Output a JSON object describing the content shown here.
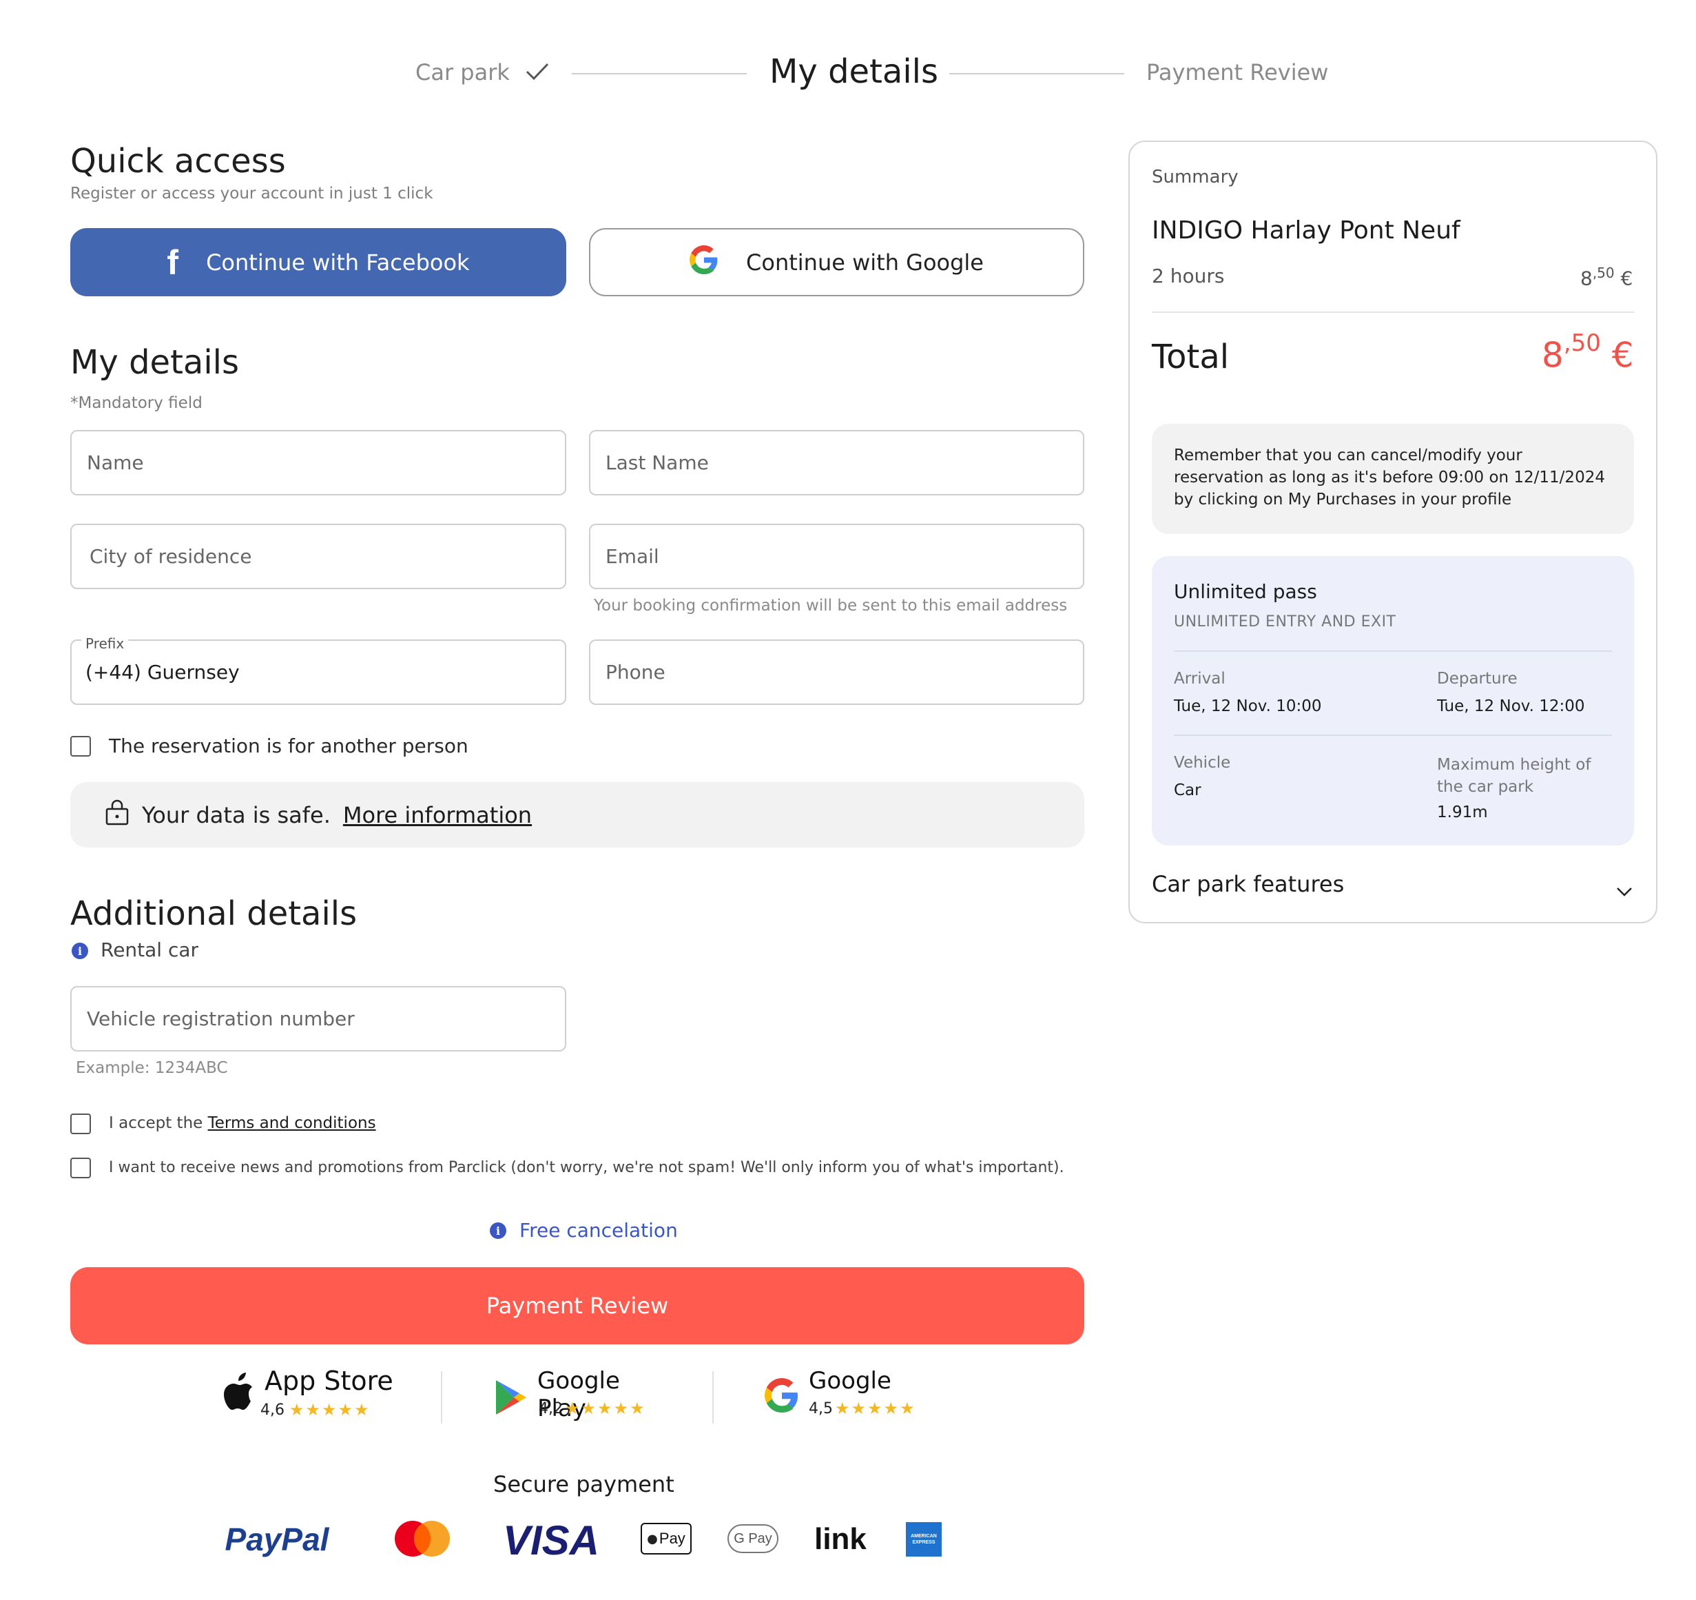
{
  "stepper": {
    "step1": "Car park",
    "step2": "My details",
    "step3": "Payment Review"
  },
  "quick_access": {
    "title": "Quick access",
    "subtitle": "Register or access your account in just 1 click",
    "facebook_label": "Continue with Facebook",
    "google_label": "Continue with Google"
  },
  "my_details": {
    "title": "My details",
    "mandatory": "*Mandatory field",
    "name_placeholder": "Name",
    "last_name_placeholder": "Last Name",
    "city_placeholder": "City of residence",
    "email_placeholder": "Email",
    "email_hint": "Your booking confirmation will be sent to this email address",
    "prefix_label": "Prefix",
    "prefix_value": "(+44) Guernsey",
    "phone_placeholder": "Phone",
    "another_person": "The reservation is for another person",
    "safe_text": "Your data is safe.",
    "safe_link": "More information"
  },
  "additional": {
    "title": "Additional details",
    "rental": "Rental car",
    "vehicle_placeholder": "Vehicle registration number",
    "vehicle_hint": "Example: 1234ABC",
    "accept_prefix": "I accept the",
    "terms_link": "Terms and conditions",
    "news_text": "I want to receive news and promotions from Parclick (don't worry, we're not spam! We'll only inform you of what's important).",
    "free_cancel": "Free cancelation",
    "payment_button": "Payment Review"
  },
  "stores": [
    {
      "name": "App Store",
      "rating": "4,6",
      "stars": "★★★★★"
    },
    {
      "name": "Google Play",
      "rating": "4,2",
      "stars": "★★★★★"
    },
    {
      "name": "Google",
      "rating": "4,5",
      "stars": "★★★★★"
    }
  ],
  "secure": {
    "title": "Secure payment",
    "methods": [
      "PayPal",
      "Mastercard",
      "VISA",
      "Apple Pay",
      "G Pay",
      "link",
      "American Express"
    ],
    "paypal_text": "PayPal",
    "visa_text": "VISA",
    "applepay_text": "Pay",
    "gpay_text": "G Pay",
    "link_text": "link",
    "amex_text": "AMERICAN EXPRESS"
  },
  "summary": {
    "label": "Summary",
    "car_park": "INDIGO Harlay Pont Neuf",
    "duration": "2 hours",
    "duration_price_int": "8",
    "duration_price_dec": ",50",
    "duration_currency": "€",
    "total_label": "Total",
    "total_int": "8",
    "total_dec": ",50",
    "total_currency": "€",
    "notice": "Remember that you can cancel/modify your reservation as long as it's before 09:00 on 12/11/2024 by clicking on My Purchases in your profile",
    "pass_title": "Unlimited pass",
    "pass_sub": "UNLIMITED ENTRY AND EXIT",
    "arrival_label": "Arrival",
    "arrival_value": "Tue, 12 Nov. 10:00",
    "departure_label": "Departure",
    "departure_value": "Tue, 12 Nov. 12:00",
    "vehicle_label": "Vehicle",
    "vehicle_value": "Car",
    "height_label": "Maximum height of the car park",
    "height_value": "1.91m",
    "features": "Car park features"
  },
  "colors": {
    "facebook": "#4367b1",
    "accent_red": "#ff5b4f",
    "total_red": "#f0524a",
    "info_blue": "#3a56c2",
    "pass_bg": "#edf0fb"
  }
}
